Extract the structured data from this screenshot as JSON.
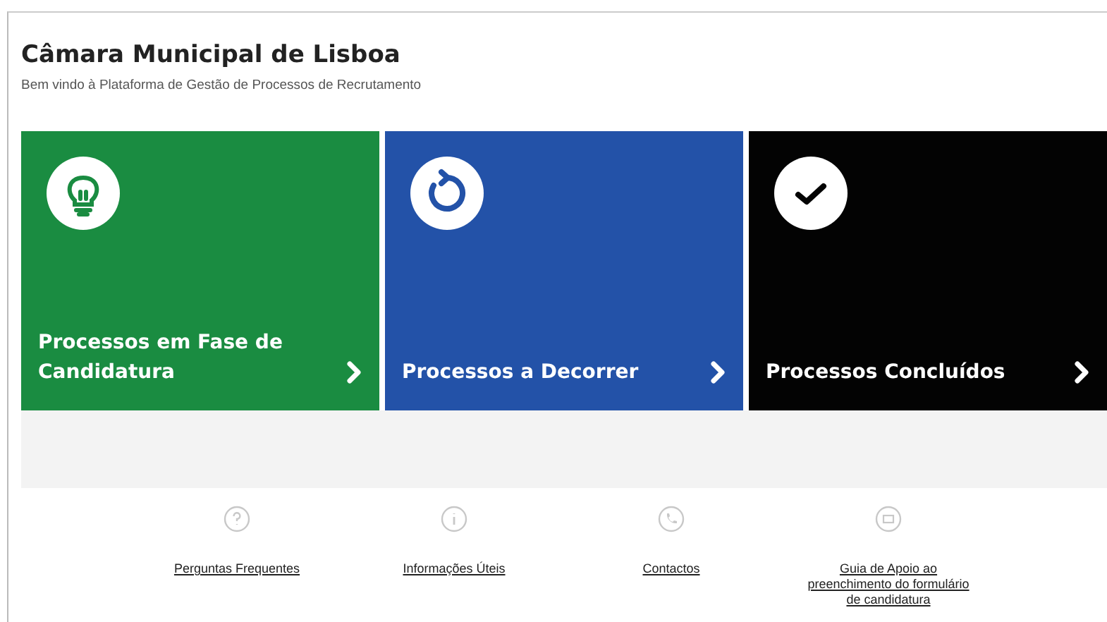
{
  "header": {
    "title": "Câmara Municipal de Lisboa",
    "subtitle": "Bem vindo à Plataforma de Gestão de Processos de Recrutamento"
  },
  "tiles": [
    {
      "kind": "bulb",
      "label": "Processos em Fase de Candidatura",
      "color": "#1a8c41"
    },
    {
      "kind": "refresh",
      "label": "Processos a Decorrer",
      "color": "#2352a8"
    },
    {
      "kind": "check",
      "label": "Processos Concluídos",
      "color": "#030303"
    }
  ],
  "links": [
    {
      "kind": "question",
      "label": "Perguntas Frequentes"
    },
    {
      "kind": "info",
      "label": "Informações Úteis"
    },
    {
      "kind": "phone",
      "label": "Contactos"
    },
    {
      "kind": "screen",
      "label": "Guia de Apoio ao preenchimento do formulário de candidatura"
    }
  ]
}
